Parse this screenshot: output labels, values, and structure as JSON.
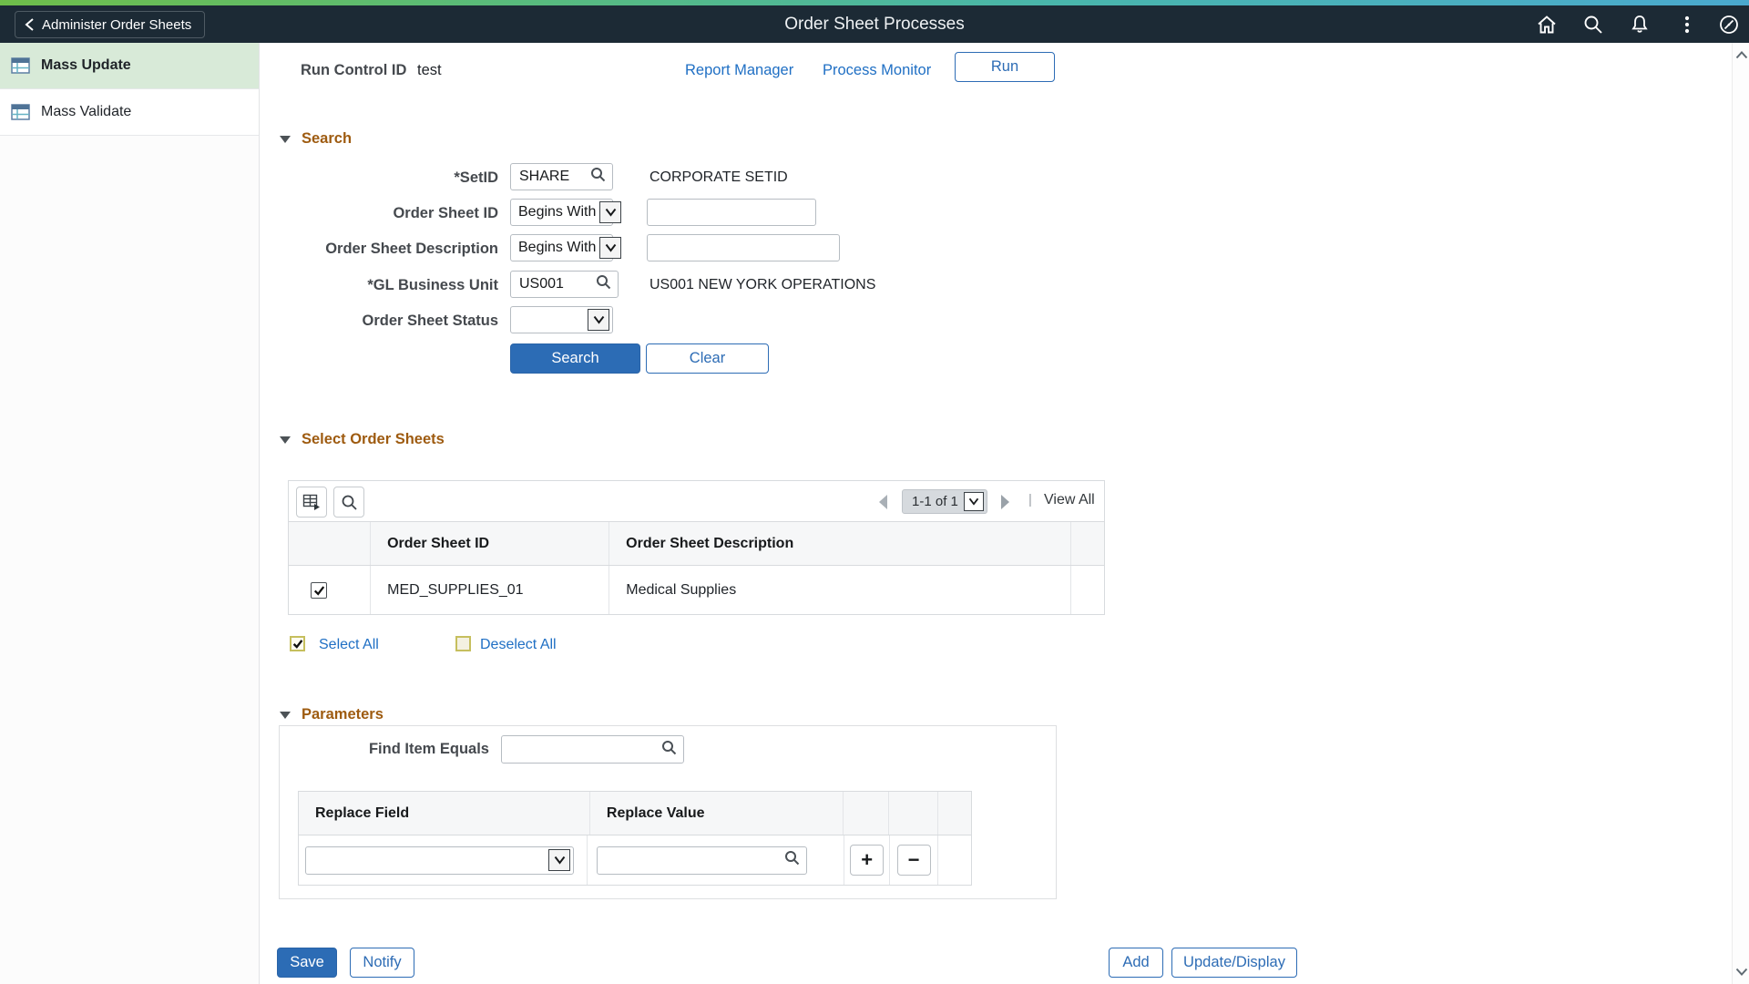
{
  "header": {
    "back_label": "Administer Order Sheets",
    "title": "Order Sheet Processes"
  },
  "sidebar": {
    "items": [
      {
        "label": "Mass Update",
        "selected": true
      },
      {
        "label": "Mass Validate",
        "selected": false
      }
    ]
  },
  "run_control": {
    "label": "Run Control ID",
    "value": "test",
    "report_manager": "Report Manager",
    "process_monitor": "Process Monitor",
    "run_button": "Run"
  },
  "search": {
    "title": "Search",
    "setid": {
      "label": "*SetID",
      "value": "SHARE",
      "related": "CORPORATE SETID"
    },
    "order_sheet_id": {
      "label": "Order Sheet ID",
      "operator": "Begins With",
      "value": ""
    },
    "order_sheet_description": {
      "label": "Order Sheet Description",
      "operator": "Begins With",
      "value": ""
    },
    "gl_business_unit": {
      "label": "*GL Business Unit",
      "value": "US001",
      "related": "US001 NEW YORK OPERATIONS"
    },
    "order_sheet_status": {
      "label": "Order Sheet Status",
      "value": ""
    },
    "search_button": "Search",
    "clear_button": "Clear"
  },
  "select_order_sheets": {
    "title": "Select Order Sheets",
    "pagination": {
      "range": "1-1 of 1",
      "separator": "|",
      "view_all": "View All"
    },
    "columns": [
      "Order Sheet ID",
      "Order Sheet Description"
    ],
    "rows": [
      {
        "selected": true,
        "id": "MED_SUPPLIES_01",
        "description": "Medical Supplies"
      }
    ],
    "select_all": "Select All",
    "deselect_all": "Deselect All"
  },
  "parameters": {
    "title": "Parameters",
    "find_item_label": "Find Item Equals",
    "find_item_value": "",
    "columns": [
      "Replace Field",
      "Replace Value"
    ],
    "rows": [
      {
        "field": "",
        "value": ""
      }
    ],
    "add_label": "+",
    "remove_label": "−"
  },
  "footer": {
    "save": "Save",
    "notify": "Notify",
    "add": "Add",
    "update_display": "Update/Display"
  },
  "colors": {
    "header_bg": "#1c2a35",
    "accent_blue": "#2c6cb5",
    "link_blue": "#1f6fc4",
    "section_orange": "#9e5b10",
    "selected_green": "#d8ead8",
    "grid_header_bg": "#f6f7f8"
  }
}
